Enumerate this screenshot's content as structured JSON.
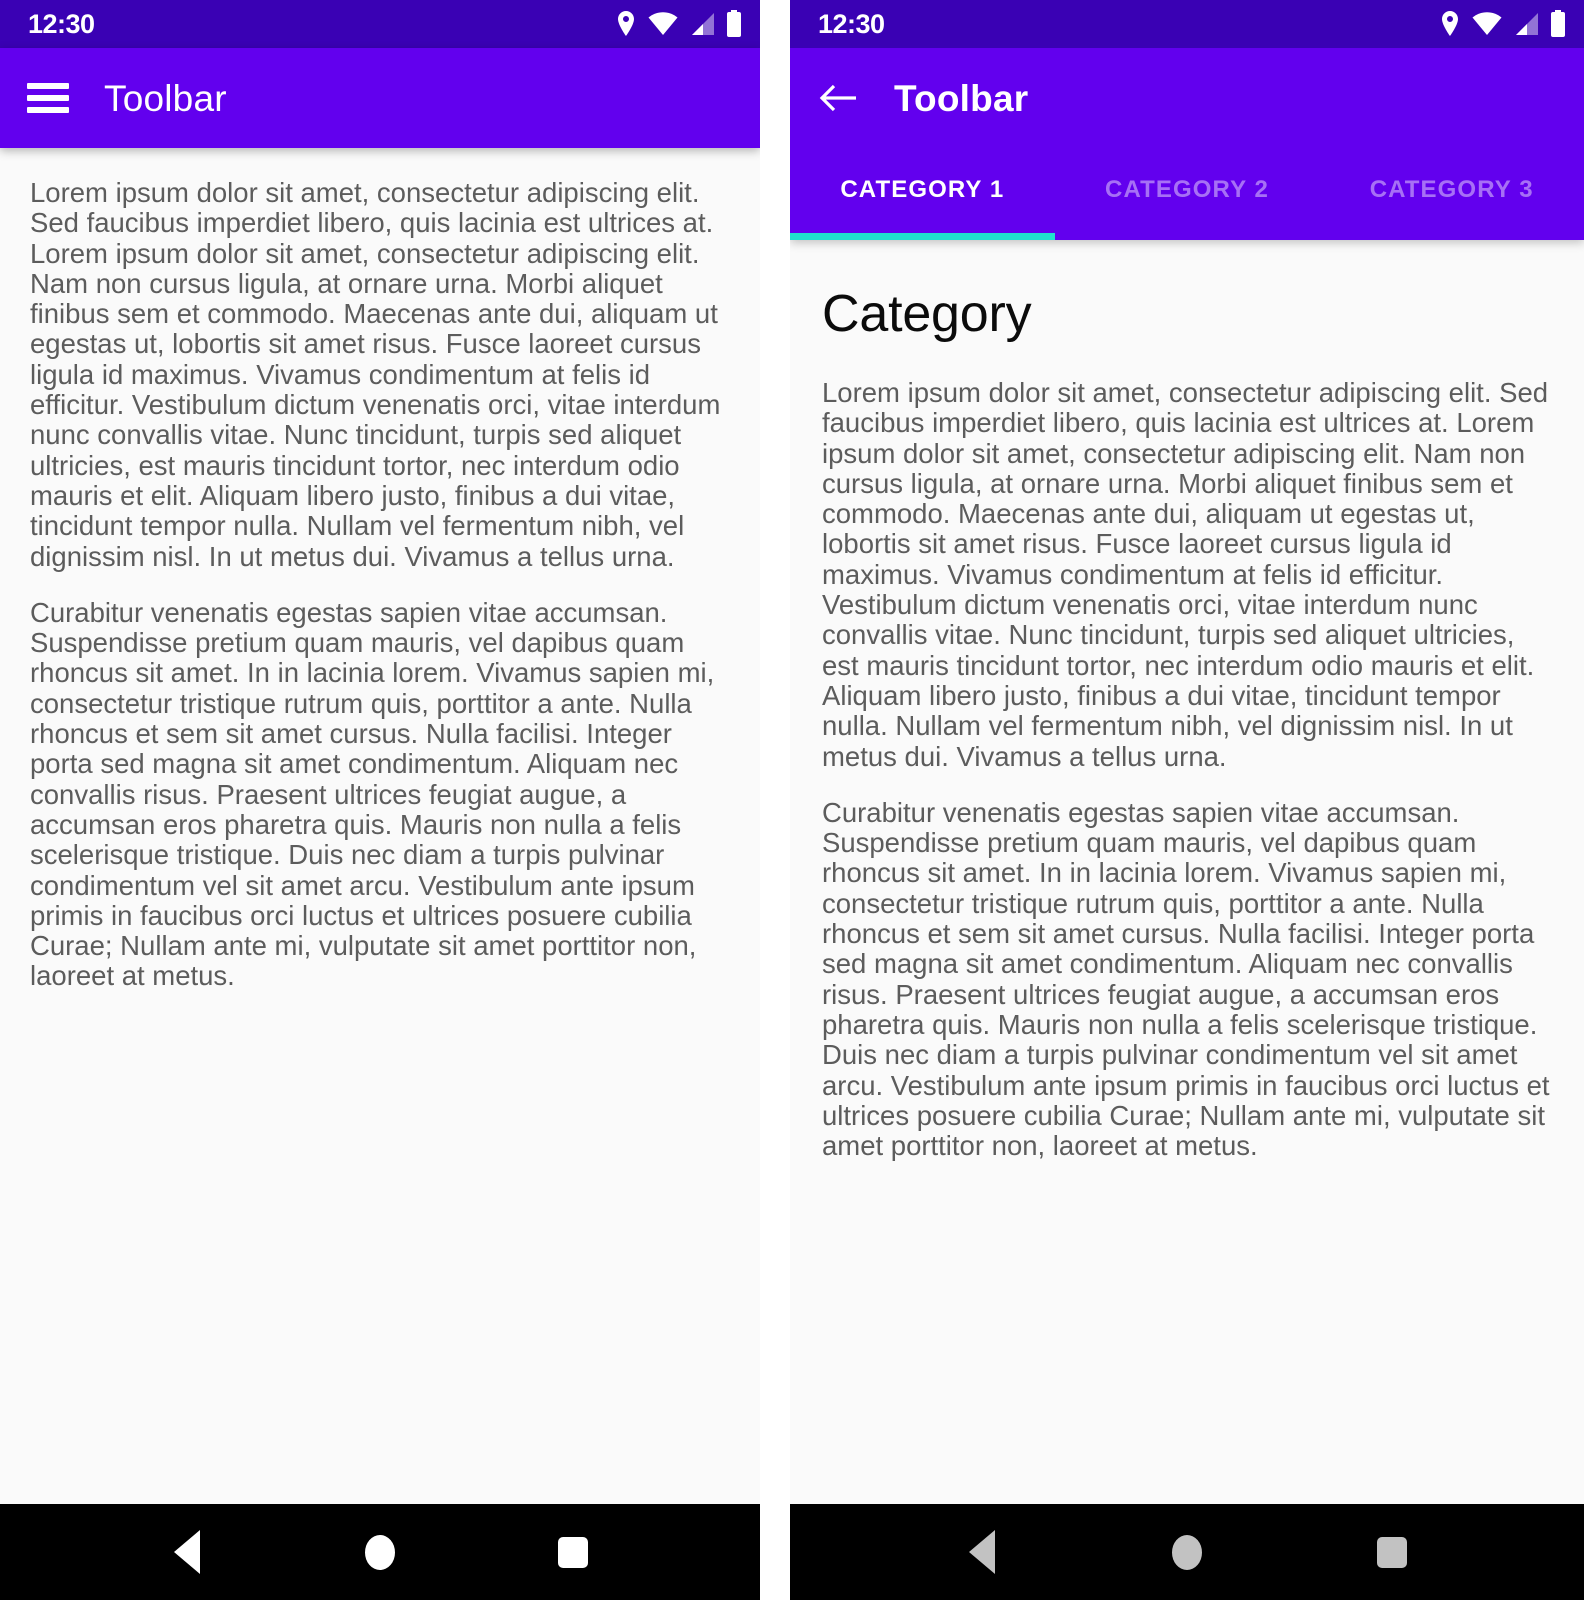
{
  "colors": {
    "status_bar": "#3a01b4",
    "toolbar": "#6200ee",
    "tab_indicator": "#1fe0cd",
    "content_bg": "#fafafa",
    "body_text": "#5c5c5c",
    "heading_text": "#0b0b0b",
    "nav_bar": "#000000",
    "nav_icon_left": "#ffffff",
    "nav_icon_right": "#c2c2c2"
  },
  "status_bar": {
    "time": "12:30",
    "icons": [
      "location-icon",
      "wifi-icon",
      "cellular-signal-icon",
      "battery-icon"
    ]
  },
  "left_screen": {
    "toolbar": {
      "menu_icon": "hamburger-menu-icon",
      "title": "Toolbar"
    },
    "paragraphs": [
      "Lorem ipsum dolor sit amet, consectetur adipiscing elit. Sed faucibus imperdiet libero, quis lacinia est ultrices at. Lorem ipsum dolor sit amet, consectetur adipiscing elit. Nam non cursus ligula, at ornare urna. Morbi aliquet finibus sem et commodo. Maecenas ante dui, aliquam ut egestas ut, lobortis sit amet risus. Fusce laoreet cursus ligula id maximus. Vivamus condimentum at felis id efficitur. Vestibulum dictum venenatis orci, vitae interdum nunc convallis vitae. Nunc tincidunt, turpis sed aliquet ultricies, est mauris tincidunt tortor, nec interdum odio mauris et elit. Aliquam libero justo, finibus a dui vitae, tincidunt tempor nulla. Nullam vel fermentum nibh, vel dignissim nisl. In ut metus dui. Vivamus a tellus urna.",
      "Curabitur venenatis egestas sapien vitae accumsan. Suspendisse pretium quam mauris, vel dapibus quam rhoncus sit amet. In in lacinia lorem. Vivamus sapien mi, consectetur tristique rutrum quis, porttitor a ante. Nulla rhoncus et sem sit amet cursus. Nulla facilisi. Integer porta sed magna sit amet condimentum. Aliquam nec convallis risus. Praesent ultrices feugiat augue, a accumsan eros pharetra quis. Mauris non nulla a felis scelerisque tristique. Duis nec diam a turpis pulvinar condimentum vel sit amet arcu. Vestibulum ante ipsum primis in faucibus orci luctus et ultrices posuere cubilia Curae; Nullam ante mi, vulputate sit amet porttitor non, laoreet at metus."
    ]
  },
  "right_screen": {
    "toolbar": {
      "back_icon": "arrow-back-icon",
      "title": "Toolbar"
    },
    "tabs": [
      {
        "label": "CATEGORY 1",
        "active": true
      },
      {
        "label": "CATEGORY 2",
        "active": false
      },
      {
        "label": "CATEGORY 3",
        "active": false
      }
    ],
    "heading": "Category",
    "paragraphs": [
      "Lorem ipsum dolor sit amet, consectetur adipiscing elit. Sed faucibus imperdiet libero, quis lacinia est ultrices at. Lorem ipsum dolor sit amet, consectetur adipiscing elit. Nam non cursus ligula, at ornare urna. Morbi aliquet finibus sem et commodo. Maecenas ante dui, aliquam ut egestas ut, lobortis sit amet risus. Fusce laoreet cursus ligula id maximus. Vivamus condimentum at felis id efficitur. Vestibulum dictum venenatis orci, vitae interdum nunc convallis vitae. Nunc tincidunt, turpis sed aliquet ultricies, est mauris tincidunt tortor, nec interdum odio mauris et elit. Aliquam libero justo, finibus a dui vitae, tincidunt tempor nulla. Nullam vel fermentum nibh, vel dignissim nisl. In ut metus dui. Vivamus a tellus urna.",
      "Curabitur venenatis egestas sapien vitae accumsan. Suspendisse pretium quam mauris, vel dapibus quam rhoncus sit amet. In in lacinia lorem. Vivamus sapien mi, consectetur tristique rutrum quis, porttitor a ante. Nulla rhoncus et sem sit amet cursus. Nulla facilisi. Integer porta sed magna sit amet condimentum. Aliquam nec convallis risus. Praesent ultrices feugiat augue, a accumsan eros pharetra quis. Mauris non nulla a felis scelerisque tristique. Duis nec diam a turpis pulvinar condimentum vel sit amet arcu. Vestibulum ante ipsum primis in faucibus orci luctus et ultrices posuere cubilia Curae; Nullam ante mi, vulputate sit amet porttitor non, laoreet at metus."
    ]
  },
  "system_nav": {
    "back": "back-triangle-icon",
    "home": "home-circle-icon",
    "recents": "recents-square-icon"
  }
}
